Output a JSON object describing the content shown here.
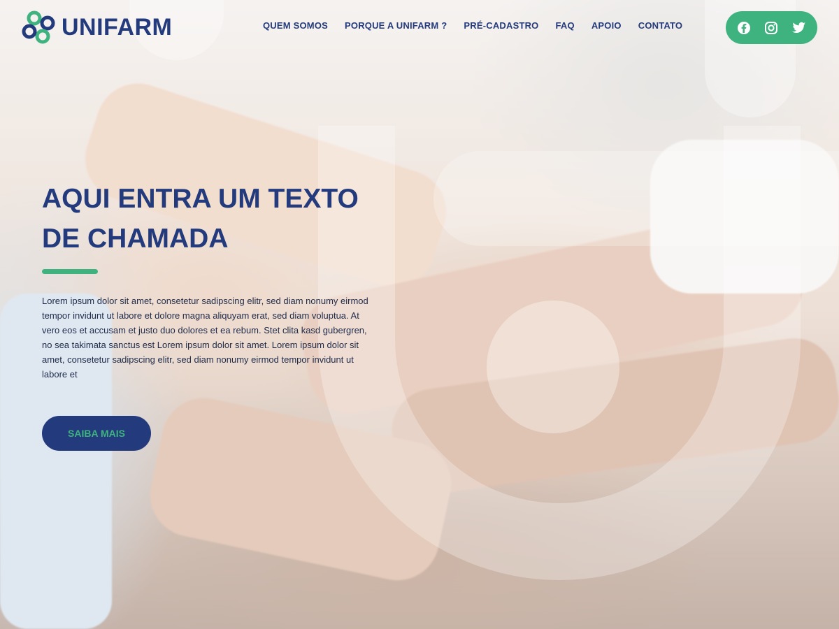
{
  "brand": {
    "name": "UNIFARM",
    "primary_color": "#233a7c",
    "accent_color": "#3fb37f"
  },
  "nav": {
    "items": [
      {
        "label": "QUEM SOMOS"
      },
      {
        "label": "PORQUE A UNIFARM ?"
      },
      {
        "label": "PRÉ-CADASTRO"
      },
      {
        "label": "FAQ"
      },
      {
        "label": "APOIO"
      },
      {
        "label": "CONTATO"
      }
    ]
  },
  "social": {
    "icons": [
      "facebook-icon",
      "instagram-icon",
      "twitter-icon"
    ]
  },
  "hero": {
    "title": "AQUI ENTRA UM TEXTO DE CHAMADA",
    "body": "Lorem ipsum dolor sit amet, consetetur sadipscing elitr, sed diam nonumy eirmod tempor invidunt ut labore et dolore magna aliquyam erat, sed diam voluptua. At vero eos et accusam et justo duo dolores et ea rebum. Stet clita kasd gubergren, no sea takimata sanctus est Lorem ipsum dolor sit amet. Lorem ipsum dolor sit amet, consetetur sadipscing elitr, sed diam nonumy eirmod tempor invidunt ut labore et",
    "cta_label": "SAIBA MAIS"
  }
}
